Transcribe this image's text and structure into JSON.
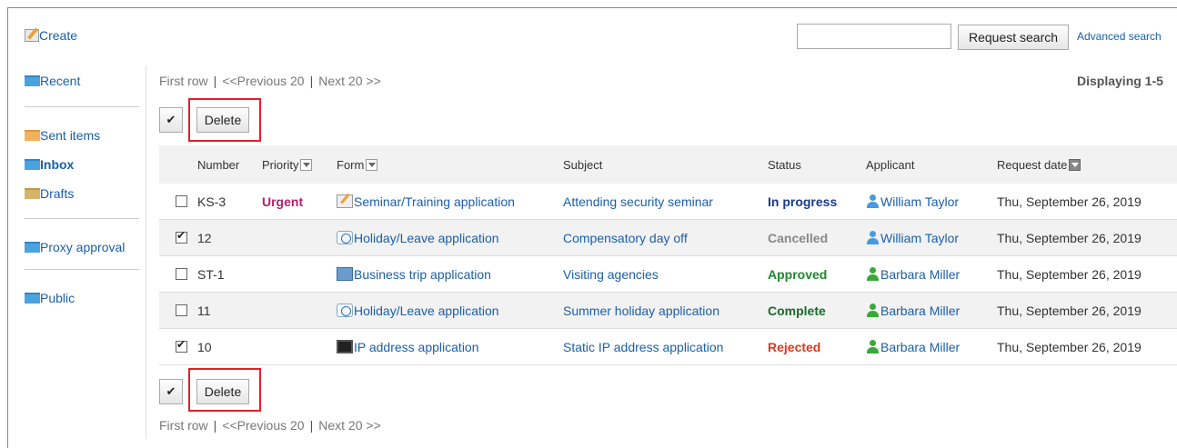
{
  "toolbar": {
    "create_label": "Create",
    "search_button": "Request search",
    "advanced_search": "Advanced search",
    "search_value": ""
  },
  "sidebar": {
    "items": [
      {
        "label": "Recent",
        "icon": "folder-blue-icon"
      },
      {
        "label": "Sent items",
        "icon": "folder-orange-icon"
      },
      {
        "label": "Inbox",
        "icon": "folder-blue-icon",
        "active": true
      },
      {
        "label": "Drafts",
        "icon": "folder-brown-icon"
      },
      {
        "label": "Proxy approval",
        "icon": "folder-blue-icon"
      },
      {
        "label": "Public",
        "icon": "folder-blue-icon"
      }
    ]
  },
  "pager": {
    "first": "First row",
    "prev": "<<Previous 20",
    "next": "Next 20 >>",
    "sep": "|",
    "displaying": "Displaying 1-5"
  },
  "actions": {
    "check_all": "✔",
    "delete": "Delete"
  },
  "table": {
    "headers": {
      "number": "Number",
      "priority": "Priority",
      "form": "Form",
      "subject": "Subject",
      "status": "Status",
      "applicant": "Applicant",
      "request_date": "Request date"
    },
    "rows": [
      {
        "checked": false,
        "number": "KS-3",
        "priority": "Urgent",
        "form": "Seminar/Training application",
        "form_icon": "pencil-icon",
        "subject": "Attending security seminar",
        "status": "In progress",
        "status_color": "#1a3a8a",
        "applicant": "William Taylor",
        "applicant_color": "#4a9ae0",
        "date": "Thu, September 26, 2019"
      },
      {
        "checked": true,
        "number": "12",
        "priority": "",
        "form": "Holiday/Leave application",
        "form_icon": "clock-icon",
        "subject": "Compensatory day off",
        "status": "Cancelled",
        "status_color": "#888888",
        "applicant": "William Taylor",
        "applicant_color": "#4a9ae0",
        "date": "Thu, September 26, 2019"
      },
      {
        "checked": false,
        "number": "ST-1",
        "priority": "",
        "form": "Business trip application",
        "form_icon": "train-icon",
        "subject": "Visiting agencies",
        "status": "Approved",
        "status_color": "#1a8a2a",
        "applicant": "Barbara Miller",
        "applicant_color": "#3aa83a",
        "date": "Thu, September 26, 2019"
      },
      {
        "checked": false,
        "number": "11",
        "priority": "",
        "form": "Holiday/Leave application",
        "form_icon": "clock-icon",
        "subject": "Summer holiday application",
        "status": "Complete",
        "status_color": "#1a6a2a",
        "applicant": "Barbara Miller",
        "applicant_color": "#3aa83a",
        "date": "Thu, September 26, 2019"
      },
      {
        "checked": true,
        "number": "10",
        "priority": "",
        "form": "IP address application",
        "form_icon": "monitor-icon",
        "subject": "Static IP address application",
        "status": "Rejected",
        "status_color": "#d83a1a",
        "applicant": "Barbara Miller",
        "applicant_color": "#3aa83a",
        "date": "Thu, September 26, 2019"
      }
    ]
  }
}
